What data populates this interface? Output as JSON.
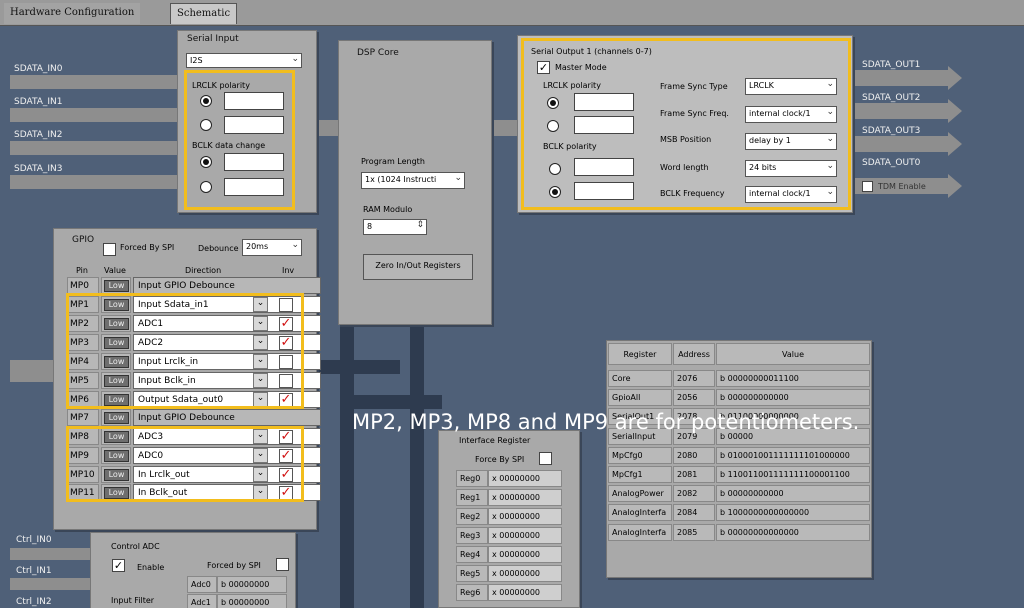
{
  "tabs": [
    "Hardware Configuration",
    "Schematic"
  ],
  "inputs": [
    "SDATA_IN0",
    "SDATA_IN1",
    "SDATA_IN2",
    "SDATA_IN3"
  ],
  "outputs": [
    "SDATA_OUT1",
    "SDATA_OUT2",
    "SDATA_OUT3",
    "SDATA_OUT0"
  ],
  "ctrl": [
    "Ctrl_IN0",
    "Ctrl_IN1",
    "Ctrl_IN2"
  ],
  "serial_input": {
    "title": "Serial Input",
    "format": "I2S",
    "lrclk_label": "LRCLK polarity",
    "bclk_label": "BCLK data change"
  },
  "dsp_core": {
    "title": "DSP Core",
    "program_length_label": "Program Length",
    "program_length_value": "1x (1024 Instructi",
    "ram_modulo_label": "RAM Modulo",
    "ram_modulo_value": "8",
    "zero_button": "Zero In/Out Registers"
  },
  "serial_output": {
    "title": "Serial Output 1 (channels 0-7)",
    "master_mode": "Master Mode",
    "lrclk_label": "LRCLK polarity",
    "bclk_label": "BCLK polarity",
    "fields": [
      {
        "label": "Frame Sync Type",
        "value": "LRCLK"
      },
      {
        "label": "Frame Sync Freq.",
        "value": "internal clock/1"
      },
      {
        "label": "MSB Position",
        "value": "delay by 1"
      },
      {
        "label": "Word length",
        "value": "24 bits"
      },
      {
        "label": "BCLK Frequency",
        "value": "internal clock/1"
      }
    ],
    "tdm_enable": "TDM Enable"
  },
  "gpio": {
    "title": "GPIO",
    "forced_by_spi": "Forced By SPI",
    "debounce_label": "Debounce",
    "debounce_value": "20ms",
    "headers": [
      "Pin",
      "Value",
      "Direction",
      "Inv"
    ],
    "rows": [
      {
        "pin": "MP0",
        "value": "Low",
        "direction": "Input GPIO Debounce",
        "inv": false
      },
      {
        "pin": "MP1",
        "value": "Low",
        "direction": "Input Sdata_in1",
        "inv": false
      },
      {
        "pin": "MP2",
        "value": "Low",
        "direction": "ADC1",
        "inv": true
      },
      {
        "pin": "MP3",
        "value": "Low",
        "direction": "ADC2",
        "inv": true
      },
      {
        "pin": "MP4",
        "value": "Low",
        "direction": "Input Lrclk_in",
        "inv": false
      },
      {
        "pin": "MP5",
        "value": "Low",
        "direction": "Input Bclk_in",
        "inv": false
      },
      {
        "pin": "MP6",
        "value": "Low",
        "direction": "Output Sdata_out0",
        "inv": true
      },
      {
        "pin": "MP7",
        "value": "Low",
        "direction": "Input GPIO Debounce",
        "inv": false
      },
      {
        "pin": "MP8",
        "value": "Low",
        "direction": "ADC3",
        "inv": true
      },
      {
        "pin": "MP9",
        "value": "Low",
        "direction": "ADC0",
        "inv": true
      },
      {
        "pin": "MP10",
        "value": "Low",
        "direction": "In Lrclk_out",
        "inv": true
      },
      {
        "pin": "MP11",
        "value": "Low",
        "direction": "In Bclk_out",
        "inv": true
      }
    ]
  },
  "interface_register": {
    "title": "Interface Register",
    "force_by_spi": "Force By SPI",
    "rows": [
      {
        "name": "Reg0",
        "value": "x 00000000"
      },
      {
        "name": "Reg1",
        "value": "x 00000000"
      },
      {
        "name": "Reg2",
        "value": "x 00000000"
      },
      {
        "name": "Reg3",
        "value": "x 00000000"
      },
      {
        "name": "Reg4",
        "value": "x 00000000"
      },
      {
        "name": "Reg5",
        "value": "x 00000000"
      },
      {
        "name": "Reg6",
        "value": "x 00000000"
      }
    ]
  },
  "register_table": {
    "headers": [
      "Register",
      "Address",
      "Value"
    ],
    "rows": [
      {
        "name": "Core",
        "address": "2076",
        "value": "b 00000000011100"
      },
      {
        "name": "GpioAll",
        "address": "2056",
        "value": "b 000000000000"
      },
      {
        "name": "SerialOut1",
        "address": "2078",
        "value": "b 01100000000000"
      },
      {
        "name": "SerialInput",
        "address": "2079",
        "value": "b 00000"
      },
      {
        "name": "MpCfg0",
        "address": "2080",
        "value": "b 010001001111111101000000"
      },
      {
        "name": "MpCfg1",
        "address": "2081",
        "value": "b 110011001111111100001100"
      },
      {
        "name": "AnalogPower",
        "address": "2082",
        "value": "b 00000000000"
      },
      {
        "name": "AnalogInterfa",
        "address": "2084",
        "value": "b 1000000000000000"
      },
      {
        "name": "AnalogInterfa",
        "address": "2085",
        "value": "b 00000000000000"
      }
    ]
  },
  "control_adc": {
    "title": "Control ADC",
    "enable": "Enable",
    "forced_by_spi": "Forced by SPI",
    "input_filter": "Input Filter",
    "rows": [
      {
        "name": "Adc0",
        "value": "b 00000000"
      },
      {
        "name": "Adc1",
        "value": "b 00000000"
      }
    ]
  },
  "annotation": "MP2, MP3, MP8 and MP9 are for potentiometers.",
  "colors": {
    "background": "#4f6078",
    "panel": "#a9a9a9",
    "highlight": "#f2bd1d",
    "check": "#d01010"
  }
}
